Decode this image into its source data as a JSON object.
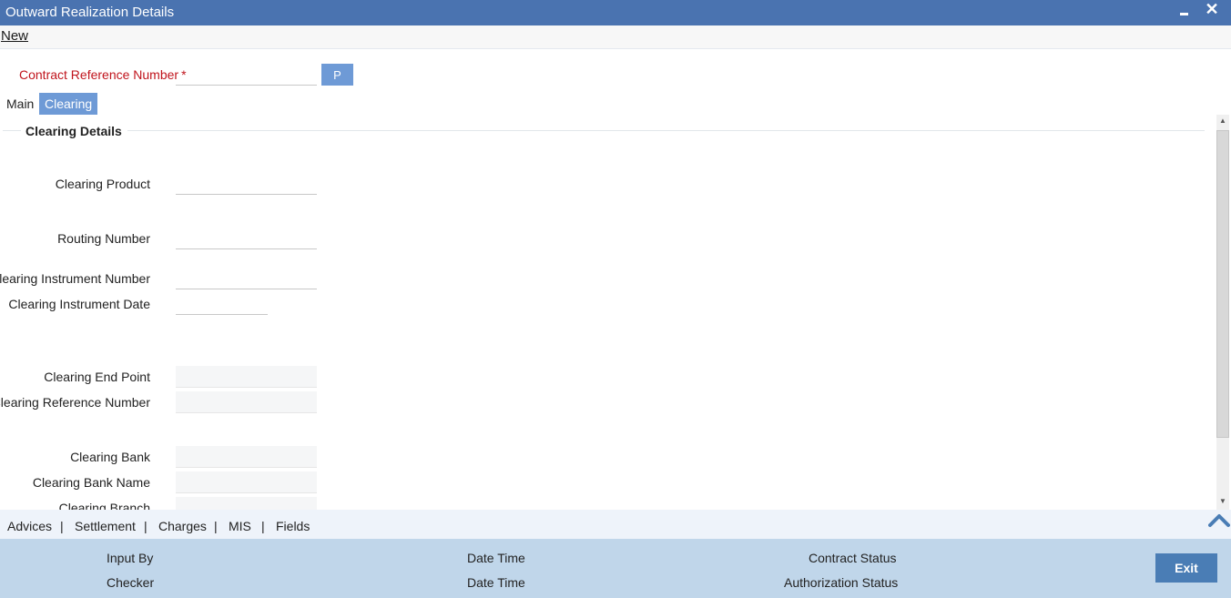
{
  "window": {
    "title": "Outward Realization Details",
    "close_glyph": "✕"
  },
  "menu": {
    "new_label": "New"
  },
  "contract": {
    "label": "Contract Reference Number",
    "required_mark": "*",
    "value": "",
    "p_button": "P"
  },
  "tabs": [
    {
      "label": "Main"
    },
    {
      "label": "Clearing"
    }
  ],
  "section": {
    "title": "Clearing Details"
  },
  "fields": {
    "clearing_product": {
      "label": "Clearing Product",
      "value": ""
    },
    "routing_number": {
      "label": "Routing Number",
      "value": ""
    },
    "instrument_number": {
      "label": "Clearing Instrument Number",
      "value": ""
    },
    "instrument_date": {
      "label": "Clearing Instrument Date",
      "value": ""
    },
    "end_point": {
      "label": "Clearing End Point",
      "value": ""
    },
    "reference_number": {
      "label": "Clearing Reference Number",
      "value": ""
    },
    "bank": {
      "label": "Clearing Bank",
      "value": ""
    },
    "bank_name": {
      "label": "Clearing Bank Name",
      "value": ""
    },
    "branch": {
      "label": "Clearing Branch",
      "value": ""
    }
  },
  "subnav": {
    "items": [
      "Advices",
      "Settlement",
      "Charges",
      "MIS",
      "Fields"
    ],
    "separator": "|"
  },
  "footer": {
    "input_by": "Input By",
    "checker": "Checker",
    "date_time_1": "Date Time",
    "date_time_2": "Date Time",
    "contract_status": "Contract Status",
    "authorization_status": "Authorization Status",
    "exit_label": "Exit"
  },
  "colors": {
    "titlebar": "#4a73b0",
    "accent": "#6e9ad6",
    "required": "#c0141c",
    "footer": "#c0d6ea",
    "exit": "#4a7db5"
  },
  "icons": {
    "minimize": "minimize-icon",
    "close": "close-icon",
    "scroll_top": "chevron-up-icon"
  }
}
